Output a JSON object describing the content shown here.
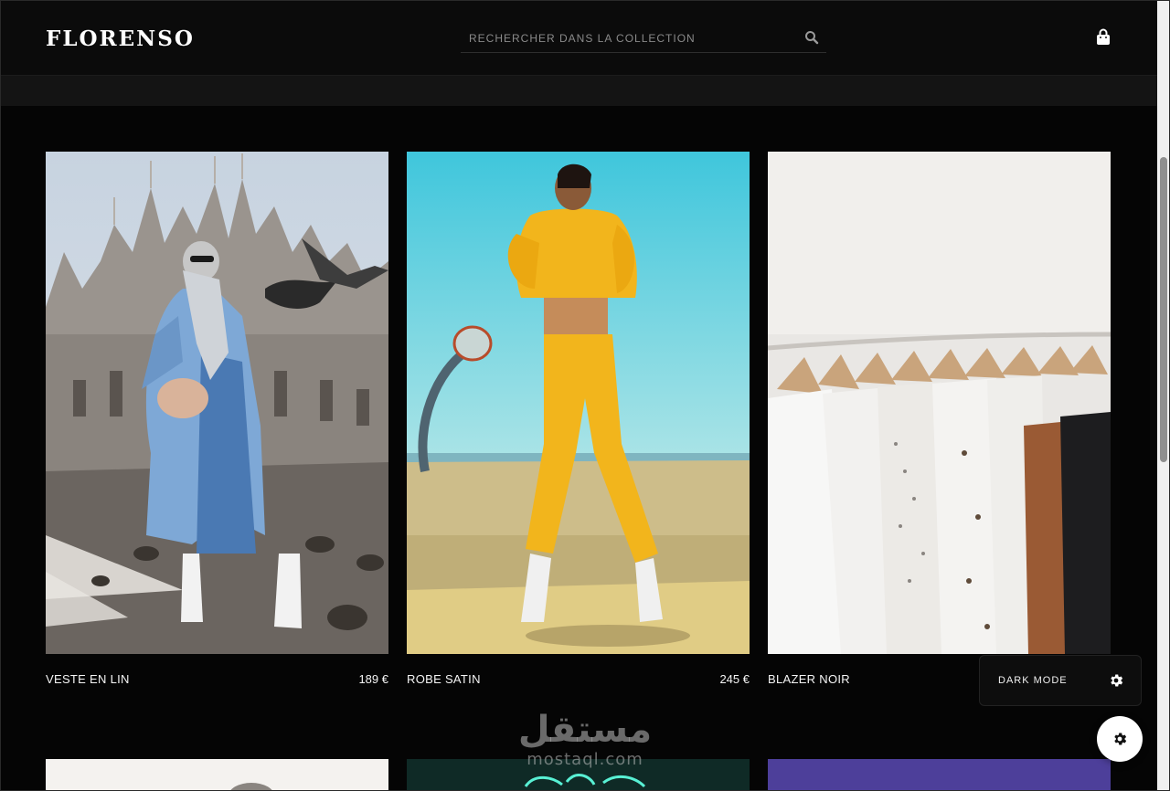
{
  "header": {
    "logo": "FLORENSO",
    "search_placeholder": "RECHERCHER DANS LA COLLECTION"
  },
  "products": [
    {
      "name": "VESTE EN LIN",
      "price": "189 €"
    },
    {
      "name": "ROBE SATIN",
      "price": "245 €"
    },
    {
      "name": "BLAZER NOIR",
      "price": ""
    }
  ],
  "theme_panel": {
    "label": "DARK MODE"
  },
  "watermark": {
    "arabic": "مستقل",
    "latin": "mostaql.com"
  },
  "icons": {
    "search": "search-icon",
    "cart": "shopping-bag-icon",
    "theme": "gear-icon",
    "settings": "gear-icon"
  },
  "colors": {
    "background": "#050505",
    "header": "#0b0b0b",
    "text": "#f5f5f5"
  }
}
